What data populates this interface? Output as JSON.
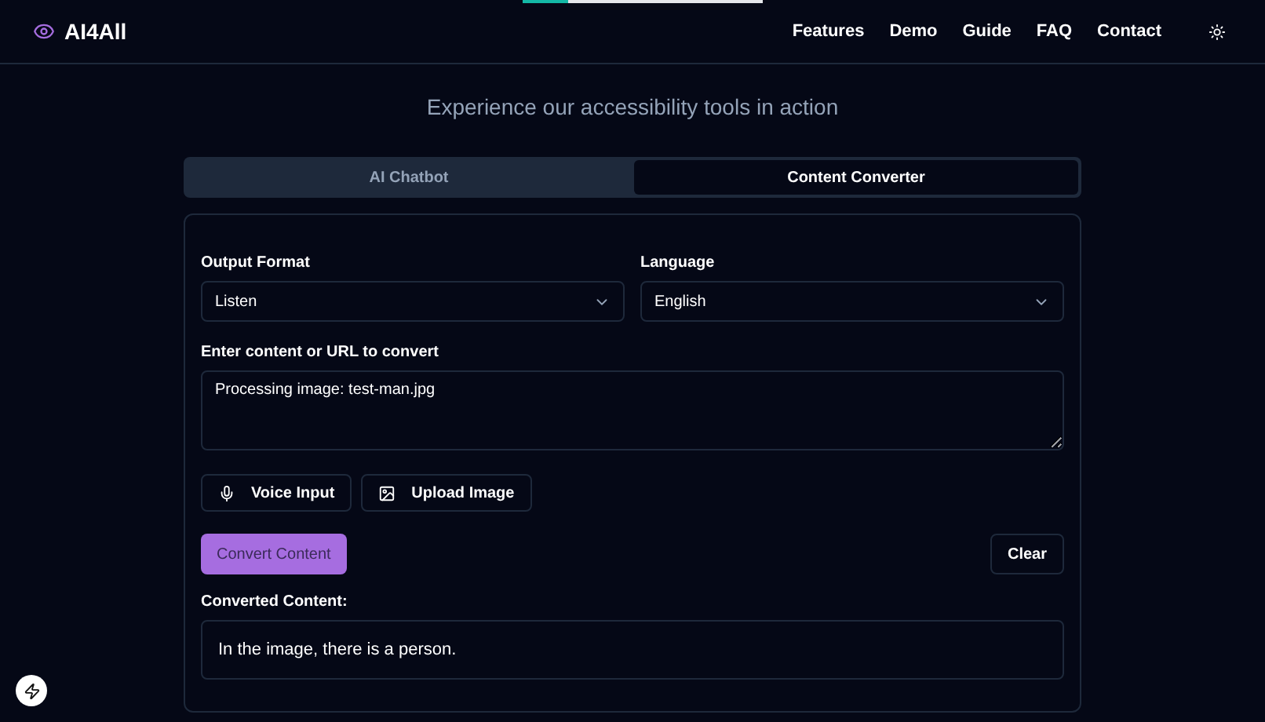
{
  "scroll_progress": {
    "level": 0.19
  },
  "header": {
    "logo": "AI4All",
    "nav": [
      "Features",
      "Demo",
      "Guide",
      "FAQ",
      "Contact"
    ]
  },
  "section": {
    "subtitle": "Experience our accessibility tools in action"
  },
  "tabs": [
    {
      "label": "AI Chatbot",
      "selected": false
    },
    {
      "label": "Content Converter",
      "selected": true
    }
  ],
  "converter": {
    "selects": [
      {
        "label": "Output Format",
        "value": "Listen"
      },
      {
        "label": "Language",
        "value": "English"
      }
    ],
    "input": {
      "label": "Enter content or URL to convert",
      "value": "Processing image: test-man.jpg"
    },
    "tools": [
      {
        "kind": "voice",
        "label": "Voice Input"
      },
      {
        "kind": "image",
        "label": "Upload Image"
      }
    ],
    "convert_button": "Convert Content",
    "clear_button": "Clear",
    "output": {
      "label": "Converted Content:",
      "text": "In the image, there is a person."
    }
  }
}
